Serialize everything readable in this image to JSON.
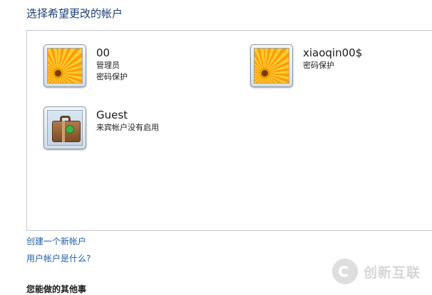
{
  "page": {
    "title": "选择希望更改的帐户"
  },
  "accounts": [
    {
      "name": "00",
      "lines": [
        "管理员",
        "密码保护"
      ],
      "picture": "orange-flower"
    },
    {
      "name": "xiaoqin00$",
      "lines": [
        "密码保护"
      ],
      "picture": "orange-flower"
    },
    {
      "name": "Guest",
      "lines": [
        "来宾帐户没有启用"
      ],
      "picture": "suitcase"
    }
  ],
  "links": {
    "create": "创建一个新帐户",
    "what_is": "用户帐户是什么?"
  },
  "other_section": {
    "heading": "您能做的其他事"
  },
  "watermark": {
    "text": "创新互联"
  }
}
